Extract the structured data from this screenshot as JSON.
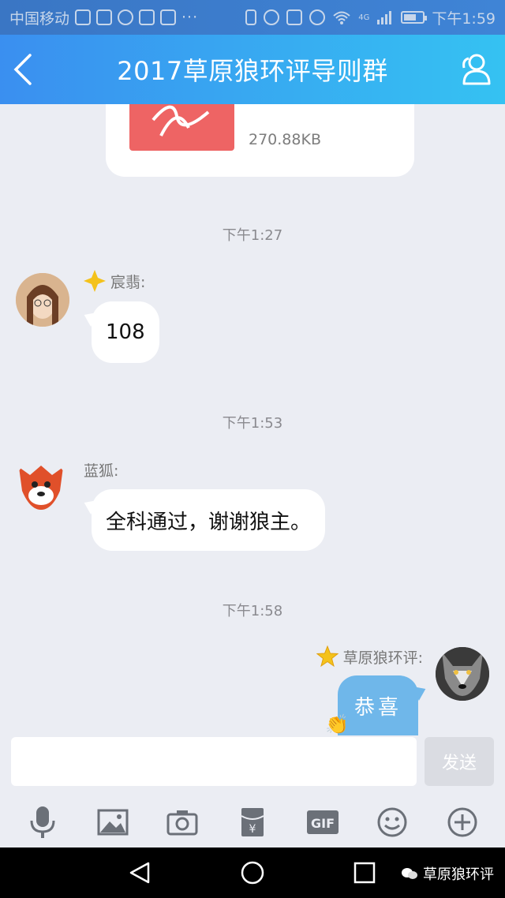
{
  "status_bar": {
    "carrier": "中国移动",
    "more": "···",
    "network": "4G",
    "time": "下午1:59"
  },
  "header": {
    "title": "2017草原狼环评导则群"
  },
  "messages": {
    "file": {
      "size": "270.88KB"
    },
    "time1": "下午1:27",
    "m1": {
      "sender": "宸翡:",
      "text": "108"
    },
    "time2": "下午1:53",
    "m2": {
      "sender": "蓝狐:",
      "text": "全科通过，谢谢狼主。"
    },
    "time3": "下午1:58",
    "m3": {
      "sender": "草原狼环评:",
      "text": "恭喜"
    }
  },
  "input": {
    "value": "",
    "send_label": "发送"
  },
  "toolbar": {
    "gif_label": "GIF"
  },
  "watermark": {
    "text": "草原狼环评"
  },
  "colors": {
    "header_start": "#3a8ff0",
    "header_end": "#35c2f2",
    "chat_bg": "#ebedf3",
    "pdf_red": "#ee6464",
    "sticker_blue": "#6fb7ea"
  }
}
